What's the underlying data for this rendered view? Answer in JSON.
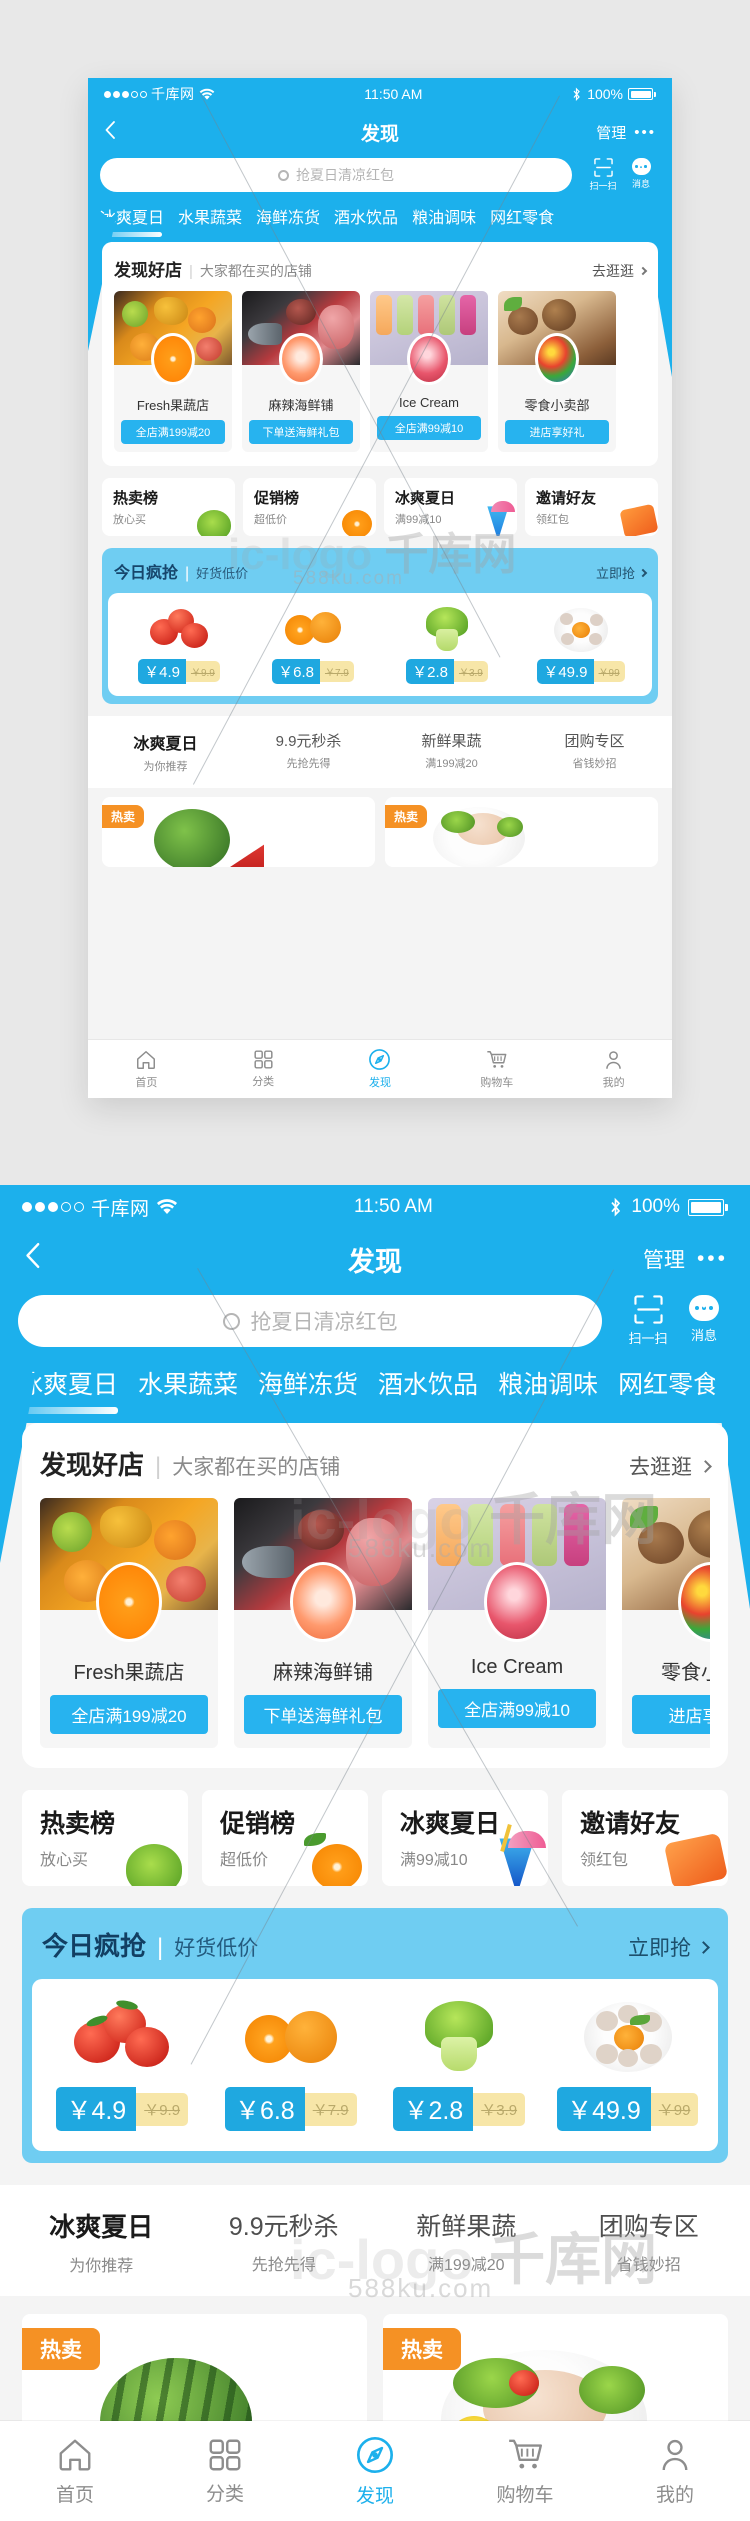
{
  "status_bar": {
    "signal_dots_filled": 3,
    "signal_dots_total": 5,
    "carrier": "千库网",
    "wifi_icon": "wifi-icon",
    "time": "11:50 AM",
    "bluetooth_icon": "bluetooth-icon",
    "battery_percent": "100%"
  },
  "nav": {
    "back_icon": "chevron-left-icon",
    "title": "发现",
    "manage_label": "管理",
    "more_icon": "more-horizontal-icon"
  },
  "search": {
    "icon": "search-icon",
    "placeholder": "抢夏日清凉红包",
    "value": "",
    "scan": {
      "icon": "scan-icon",
      "label": "扫一扫"
    },
    "message": {
      "icon": "message-icon",
      "label": "消息"
    }
  },
  "categories": [
    {
      "label": "冰爽夏日",
      "active": true
    },
    {
      "label": "水果蔬菜",
      "active": false
    },
    {
      "label": "海鲜冻货",
      "active": false
    },
    {
      "label": "酒水饮品",
      "active": false
    },
    {
      "label": "粮油调味",
      "active": false
    },
    {
      "label": "网红零食",
      "active": false
    }
  ],
  "stores_section": {
    "title": "发现好店",
    "divider": "|",
    "subtitle": "大家都在买的店铺",
    "more_label": "去逛逛",
    "more_icon": "chevron-right-icon",
    "items": [
      {
        "name": "Fresh果蔬店",
        "tag": "全店满199减20",
        "photo": "assorted-fruit-photo",
        "avatar": "orange-slice-photo"
      },
      {
        "name": "麻辣海鲜铺",
        "tag": "下单送海鲜礼包",
        "photo": "seafood-platter-photo",
        "avatar": "shrimp-dish-photo"
      },
      {
        "name": "Ice Cream",
        "tag": "全店满99减10",
        "photo": "popsicles-photo",
        "avatar": "strawberry-popsicle-photo"
      },
      {
        "name": "零食小卖部",
        "tag": "进店享好礼",
        "photo": "chocolate-nuts-photo",
        "avatar": "candy-bowl-photo"
      }
    ]
  },
  "quad_cards": [
    {
      "title": "热卖榜",
      "subtitle": "放心买",
      "icon": "lettuce-icon"
    },
    {
      "title": "促销榜",
      "subtitle": "超低价",
      "icon": "orange-icon"
    },
    {
      "title": "冰爽夏日",
      "subtitle": "满99减10",
      "icon": "cocktail-icon"
    },
    {
      "title": "邀请好友",
      "subtitle": "领红包",
      "icon": "wallet-icon"
    }
  ],
  "rush_section": {
    "title": "今日疯抢",
    "divider": "|",
    "subtitle": "好货低价",
    "more_label": "立即抢",
    "more_icon": "chevron-right-icon",
    "items": [
      {
        "photo": "tomatoes-photo",
        "price": "￥4.9",
        "old_price": "￥9.9"
      },
      {
        "photo": "oranges-photo",
        "price": "￥6.8",
        "old_price": "￥7.9"
      },
      {
        "photo": "lettuce-photo",
        "price": "￥2.8",
        "old_price": "￥3.9"
      },
      {
        "photo": "shrimp-plate-photo",
        "price": "￥49.9",
        "old_price": "￥99"
      }
    ]
  },
  "entries": [
    {
      "title": "冰爽夏日",
      "subtitle": "为你推荐",
      "highlighted": true
    },
    {
      "title": "9.9元秒杀",
      "subtitle": "先抢先得",
      "highlighted": false
    },
    {
      "title": "新鲜果蔬",
      "subtitle": "满199减20",
      "highlighted": false
    },
    {
      "title": "团购专区",
      "subtitle": "省钱妙招",
      "highlighted": false
    }
  ],
  "hot_cards": [
    {
      "badge": "热卖",
      "photo": "watermelon-photo"
    },
    {
      "badge": "热卖",
      "photo": "chicken-salad-photo"
    }
  ],
  "tabbar": [
    {
      "label": "首页",
      "icon": "home-icon",
      "active": false
    },
    {
      "label": "分类",
      "icon": "grid-icon",
      "active": false
    },
    {
      "label": "发现",
      "icon": "discover-icon",
      "active": true
    },
    {
      "label": "购物车",
      "icon": "cart-icon",
      "active": false
    },
    {
      "label": "我的",
      "icon": "person-icon",
      "active": false
    }
  ],
  "watermark": {
    "brand": "千库网",
    "domain": "588ku.com",
    "logo": "ic-logo"
  },
  "colors": {
    "brand_blue": "#1cb0ec",
    "light_blue": "#6fcdf2",
    "price_blue": "#1fa8e0",
    "old_price_bg": "#f7e6a8",
    "hot_orange": "#f59124",
    "page_bg": "#e8e8e8"
  }
}
